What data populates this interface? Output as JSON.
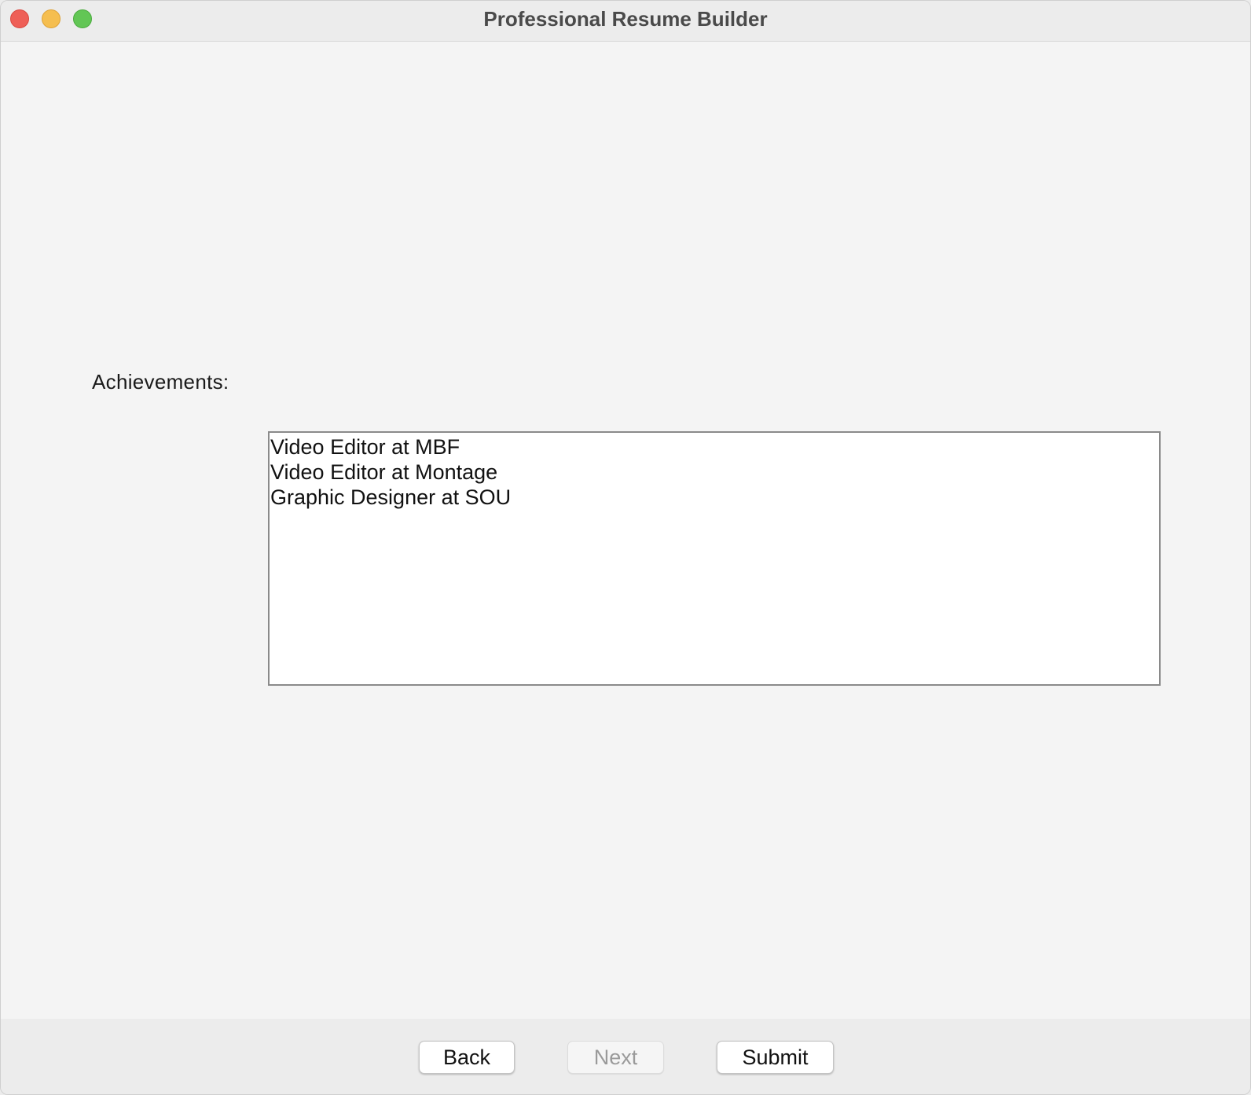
{
  "window": {
    "title": "Professional Resume Builder"
  },
  "form": {
    "achievements_label": "Achievements:",
    "achievements_items": [
      "Video Editor at MBF",
      "Video Editor at Montage",
      "Graphic Designer at SOU"
    ]
  },
  "footer": {
    "back_label": "Back",
    "next_label": "Next",
    "next_enabled": false,
    "submit_label": "Submit"
  },
  "colors": {
    "close": "#ee5f57",
    "minimize": "#f5be4f",
    "zoom": "#62c655",
    "background": "#f4f4f4",
    "footer_background": "#ececec"
  }
}
